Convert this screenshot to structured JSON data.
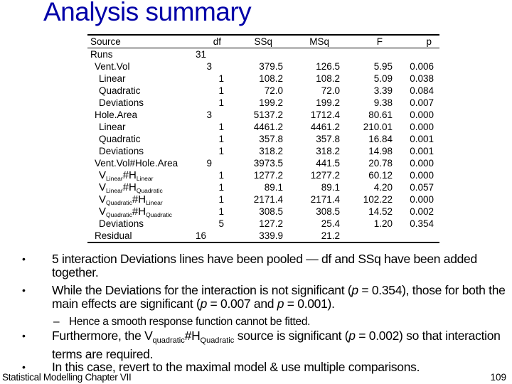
{
  "slide": {
    "title": "Analysis summary",
    "footer": {
      "left": "Statistical Modelling   Chapter VII",
      "page_number": "109"
    }
  },
  "table": {
    "headers": {
      "source": "Source",
      "df": "df",
      "ssq": "SSq",
      "msq": "MSq",
      "f": "F",
      "p": "p"
    },
    "rows": [
      {
        "source": "Runs",
        "df": "31",
        "ssq": "",
        "msq": "",
        "f": "",
        "p": ""
      },
      {
        "source": "Vent.Vol",
        "df": "3",
        "ssq": "379.5",
        "msq": "126.5",
        "f": "5.95",
        "p": "0.006"
      },
      {
        "source": "Linear",
        "df": "1",
        "ssq": "108.2",
        "msq": "108.2",
        "f": "5.09",
        "p": "0.038"
      },
      {
        "source": "Quadratic",
        "df": "1",
        "ssq": "72.0",
        "msq": "72.0",
        "f": "3.39",
        "p": "0.084"
      },
      {
        "source": "Deviations",
        "df": "1",
        "ssq": "199.2",
        "msq": "199.2",
        "f": "9.38",
        "p": "0.007"
      },
      {
        "source": "Hole.Area",
        "df": "3",
        "ssq": "5137.2",
        "msq": "1712.4",
        "f": "80.61",
        "p": "0.000"
      },
      {
        "source": "Linear",
        "df": "1",
        "ssq": "4461.2",
        "msq": "4461.2",
        "f": "210.01",
        "p": "0.000"
      },
      {
        "source": "Quadratic",
        "df": "1",
        "ssq": "357.8",
        "msq": "357.8",
        "f": "16.84",
        "p": "0.001"
      },
      {
        "source": "Deviations",
        "df": "1",
        "ssq": "318.2",
        "msq": "318.2",
        "f": "14.98",
        "p": "0.001"
      },
      {
        "source": "Vent.Vol#Hole.Area",
        "df": "9",
        "ssq": "3973.5",
        "msq": "441.5",
        "f": "20.78",
        "p": "0.000"
      },
      {
        "source_v": "V",
        "source_vsub": "Linear",
        "source_h": "#H",
        "source_hsub": "Linear",
        "df": "1",
        "ssq": "1277.2",
        "msq": "1277.2",
        "f": "60.12",
        "p": "0.000"
      },
      {
        "source_v": "V",
        "source_vsub": "Linear",
        "source_h": "#H",
        "source_hsub": "Quadratic",
        "df": "1",
        "ssq": "89.1",
        "msq": "89.1",
        "f": "4.20",
        "p": "0.057"
      },
      {
        "source_v": "V",
        "source_vsub": "Quadratic",
        "source_h": "#H",
        "source_hsub": "Linear",
        "df": "1",
        "ssq": "2171.4",
        "msq": "2171.4",
        "f": "102.22",
        "p": "0.000"
      },
      {
        "source_v": "V",
        "source_vsub": "Quadratic",
        "source_h": "#H",
        "source_hsub": "Quadratic",
        "df": "1",
        "ssq": "308.5",
        "msq": "308.5",
        "f": "14.52",
        "p": "0.002"
      },
      {
        "source": "Deviations",
        "df": "5",
        "ssq": "127.2",
        "msq": "25.4",
        "f": "1.20",
        "p": "0.354"
      },
      {
        "source": "Residual",
        "df": "16",
        "ssq": "339.9",
        "msq": "21.2",
        "f": "",
        "p": ""
      }
    ]
  },
  "bullets": {
    "b1": {
      "text": "5 interaction Deviations lines have been pooled — df and SSq have been added together."
    },
    "b2": {
      "pre": "While the Deviations for the interaction is not significant (",
      "p1_sym": "p",
      "p1_val": " = 0.354),",
      "mid": " those for both the main effects are significant (",
      "p2_sym": "p",
      "p2_val": " = 0.007 and ",
      "p3_sym": "p",
      "p3_val": " = 0.001)."
    },
    "b2_sub": {
      "text": "Hence a smooth response function cannot be fitted."
    },
    "b3": {
      "pre": "Furthermore, the V",
      "vsub": "quadratic",
      "h": "#H",
      "hsub": "Quadratic",
      "mid": " source is significant (",
      "p_sym": "p",
      "p_val": " = 0.002) so that interaction terms are required."
    },
    "b4": {
      "text": "In this case, revert to the maximal model & use multiple comparisons."
    }
  }
}
